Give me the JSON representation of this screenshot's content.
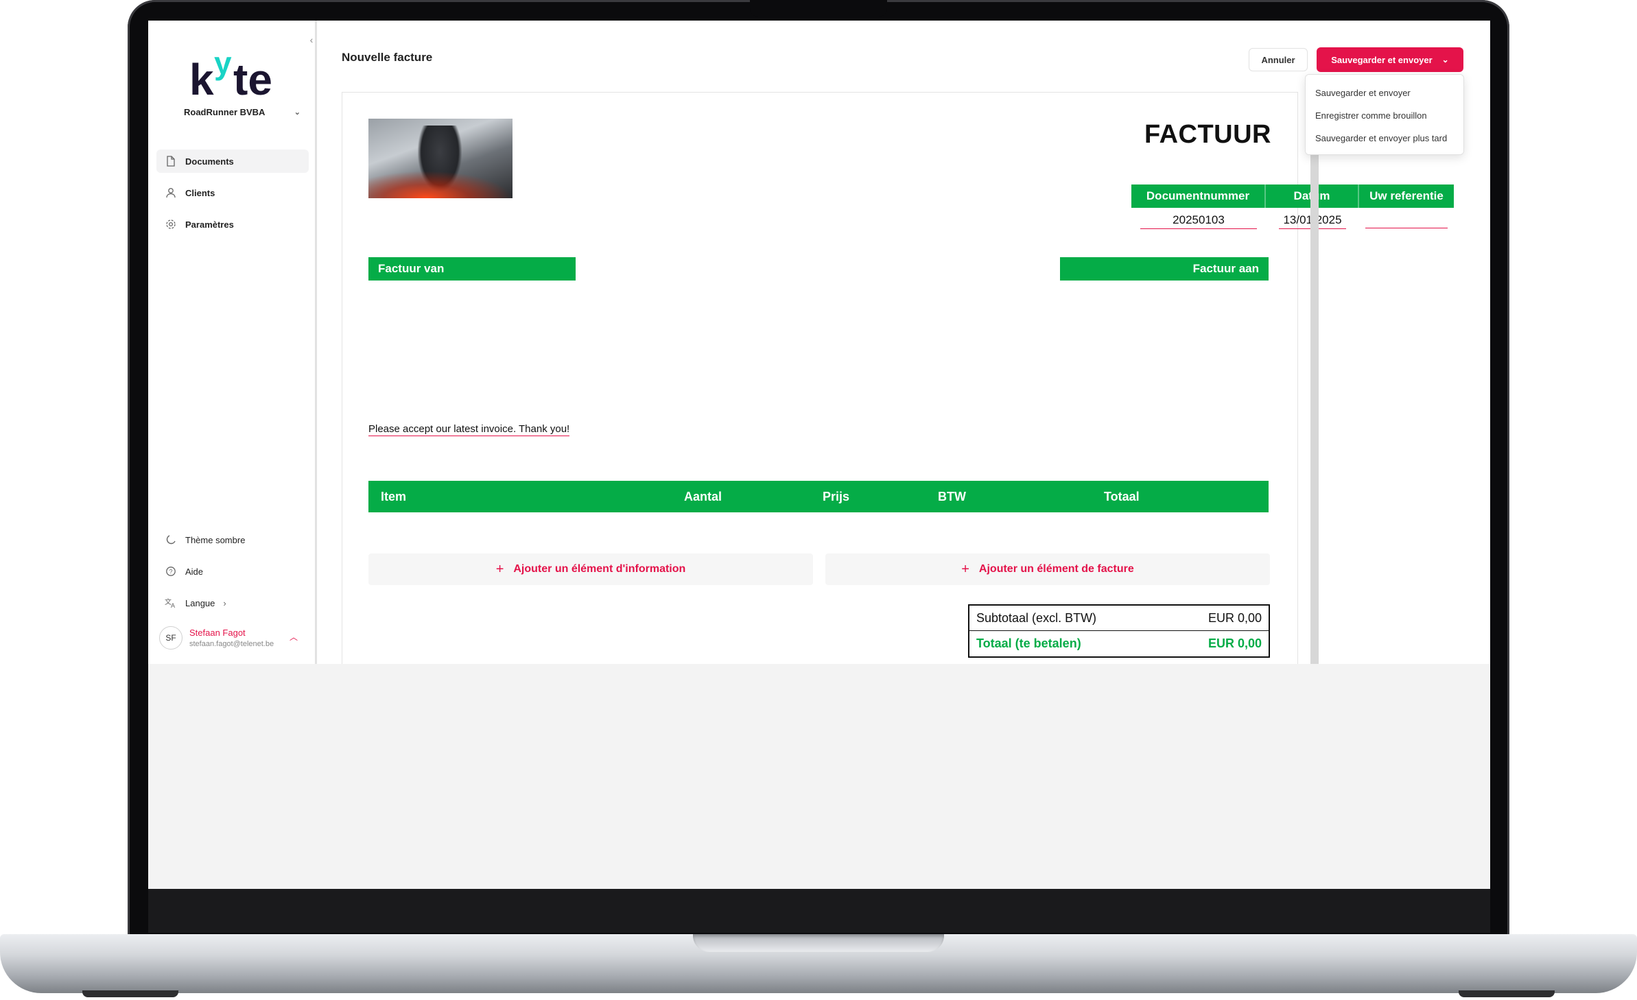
{
  "sidebar": {
    "logo_text": "kyte",
    "company": "RoadRunner BVBA",
    "nav": [
      {
        "label": "Documents",
        "icon": "document-icon"
      },
      {
        "label": "Clients",
        "icon": "user-icon"
      },
      {
        "label": "Paramètres",
        "icon": "gear-icon"
      }
    ],
    "bottom": [
      {
        "label": "Thème sombre",
        "icon": "moon-icon"
      },
      {
        "label": "Aide",
        "icon": "help-icon"
      },
      {
        "label": "Langue",
        "icon": "translate-icon"
      }
    ],
    "user": {
      "initials": "SF",
      "name": "Stefaan Fagot",
      "email": "stefaan.fagot@telenet.be"
    }
  },
  "header": {
    "title": "Nouvelle facture",
    "cancel_label": "Annuler",
    "save_label": "Sauvegarder et envoyer"
  },
  "save_menu": [
    "Sauvegarder et envoyer",
    "Enregistrer comme brouillon",
    "Sauvegarder et envoyer plus tard"
  ],
  "invoice": {
    "heading": "FACTUUR",
    "meta_headers": [
      "Documentnummer",
      "Datum",
      "Uw referentie"
    ],
    "meta_values": [
      "20250103",
      "13/01/2025",
      ""
    ],
    "from_label": "Factuur van",
    "to_label": "Factuur aan",
    "note": "Please accept our latest invoice. Thank you!",
    "item_columns": [
      "Item",
      "Aantal",
      "Prijs",
      "BTW",
      "Totaal"
    ],
    "add_info_label": "Ajouter un élément d'information",
    "add_item_label": "Ajouter un élément de facture",
    "totals": [
      {
        "label": "Subtotaal (excl. BTW)",
        "value": "EUR 0,00"
      },
      {
        "label": "Totaal (te betalen)",
        "value": "EUR 0,00"
      }
    ]
  },
  "colors": {
    "accent": "#e4134a",
    "green": "#05ac47",
    "logo_y": "#19d3c5"
  }
}
